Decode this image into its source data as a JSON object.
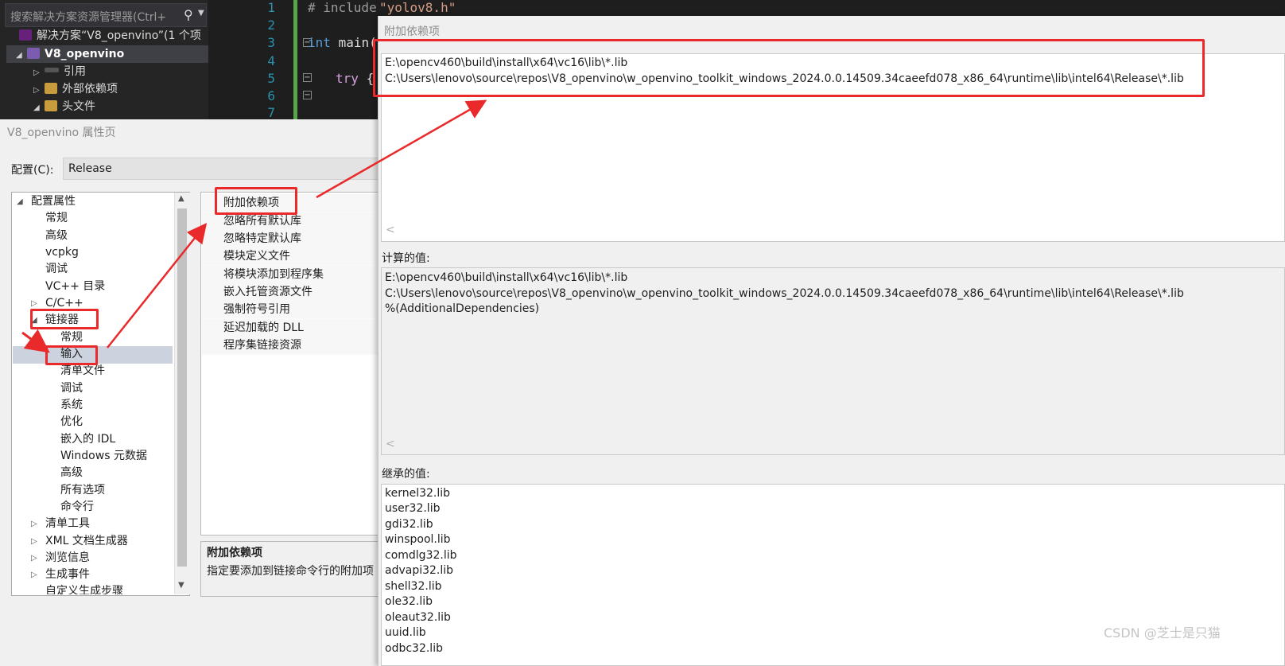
{
  "solution_explorer": {
    "search_placeholder": "搜索解决方案资源管理器(Ctrl+",
    "items": [
      {
        "label": "解决方案“V8_openvino”(1 个项"
      },
      {
        "label": "V8_openvino"
      },
      {
        "label": "引用"
      },
      {
        "label": "外部依赖项"
      },
      {
        "label": "头文件"
      }
    ]
  },
  "editor": {
    "line_numbers": [
      "1",
      "2",
      "3",
      "4",
      "5",
      "6",
      "7"
    ],
    "code": {
      "line1_directive": "# include",
      "line1_string": "\"yolov8.h\"",
      "line3_keyword": "int",
      "line3_rest": " main(",
      "line5_keyword": "try",
      "line5_rest": " {"
    }
  },
  "dialog": {
    "title": "V8_openvino 属性页",
    "config_label": "配置(C):",
    "config_value": "Release",
    "tree": [
      "配置属性",
      "常规",
      "高级",
      "vcpkg",
      "调试",
      "VC++ 目录",
      "C/C++",
      "链接器",
      "常规",
      "输入",
      "清单文件",
      "调试",
      "系统",
      "优化",
      "嵌入的 IDL",
      "Windows 元数据",
      "高级",
      "所有选项",
      "命令行",
      "清单工具",
      "XML 文档生成器",
      "浏览信息",
      "生成事件",
      "自定义生成步骤"
    ],
    "properties": [
      "附加依赖项",
      "忽略所有默认库",
      "忽略特定默认库",
      "模块定义文件",
      "将模块添加到程序集",
      "嵌入托管资源文件",
      "强制符号引用",
      "延迟加载的 DLL",
      "程序集链接资源"
    ],
    "description_title": "附加依赖项",
    "description_text": "指定要添加到链接命令行的附加项"
  },
  "popup": {
    "title": "附加依赖项",
    "dependencies": [
      "E:\\opencv460\\build\\install\\x64\\vc16\\lib\\*.lib",
      "C:\\Users\\lenovo\\source\\repos\\V8_openvino\\w_openvino_toolkit_windows_2024.0.0.14509.34caeefd078_x86_64\\runtime\\lib\\intel64\\Release\\*.lib"
    ],
    "computed_label": "计算的值:",
    "computed": [
      "E:\\opencv460\\build\\install\\x64\\vc16\\lib\\*.lib",
      "C:\\Users\\lenovo\\source\\repos\\V8_openvino\\w_openvino_toolkit_windows_2024.0.0.14509.34caeefd078_x86_64\\runtime\\lib\\intel64\\Release\\*.lib",
      "%(AdditionalDependencies)"
    ],
    "inherited_label": "继承的值:",
    "inherited": [
      "kernel32.lib",
      "user32.lib",
      "gdi32.lib",
      "winspool.lib",
      "comdlg32.lib",
      "advapi32.lib",
      "shell32.lib",
      "ole32.lib",
      "oleaut32.lib",
      "uuid.lib",
      "odbc32.lib"
    ]
  },
  "watermark": "CSDN @芝士是只猫",
  "colors": {
    "annotation_red": "#ea2a2a",
    "ide_bg": "#1e1e1e",
    "selection": "#cdd3de"
  }
}
